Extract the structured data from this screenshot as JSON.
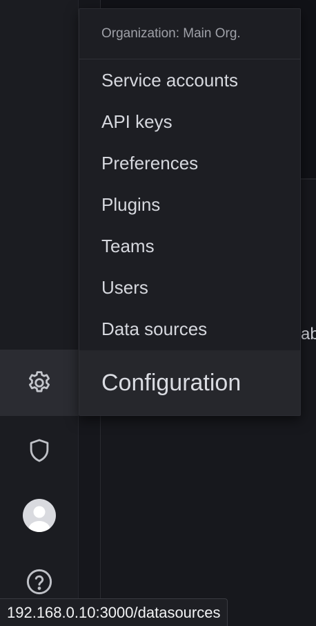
{
  "sidenav": {
    "items": [
      {
        "icon": "gear-icon",
        "active": true
      },
      {
        "icon": "shield-icon"
      },
      {
        "icon": "avatar-icon"
      },
      {
        "icon": "help-icon"
      }
    ]
  },
  "background": {
    "partial_text": "abe"
  },
  "menu": {
    "header": "Organization: Main Org.",
    "items": [
      "Service accounts",
      "API keys",
      "Preferences",
      "Plugins",
      "Teams",
      "Users",
      "Data sources"
    ],
    "title": "Configuration"
  },
  "status_bar": {
    "url": "192.168.0.10:3000/datasources"
  },
  "colors": {
    "nav_bg": "#1b1c21",
    "menu_bg": "#1d1e23",
    "active_bg": "#26272c",
    "text": "#d6d8de",
    "icon": "#bfc1c7"
  }
}
